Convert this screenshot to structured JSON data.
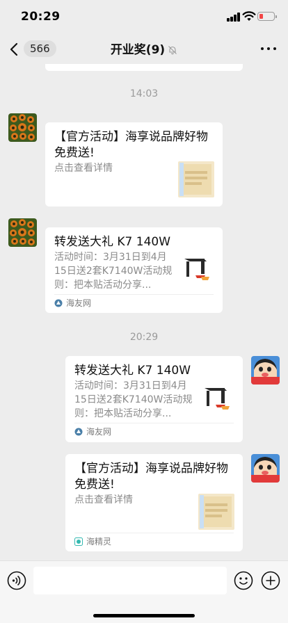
{
  "status_bar": {
    "time": "20:29"
  },
  "header": {
    "unread_count": "566",
    "title": "开业奖(9)"
  },
  "icons": {
    "battery_color": "#f34646"
  },
  "messages": {
    "time_1": "14:03",
    "time_2": "20:29",
    "m1": {
      "title": "【官方活动】海享说品牌好物免费送!",
      "desc": "点击查看详情"
    },
    "m2": {
      "title": "转发送大礼 K7 140W",
      "desc": "活动时间：3月31日到4月15日送2套K7140W活动规则：把本贴活动分享...",
      "source": "海友网"
    },
    "m3": {
      "title": "转发送大礼 K7 140W",
      "desc": "活动时间：3月31日到4月15日送2套K7140W活动规则：把本贴活动分享...",
      "source": "海友网"
    },
    "m4": {
      "title": "【官方活动】海享说品牌好物免费送!",
      "desc": "点击查看详情",
      "source": "海精灵"
    }
  }
}
